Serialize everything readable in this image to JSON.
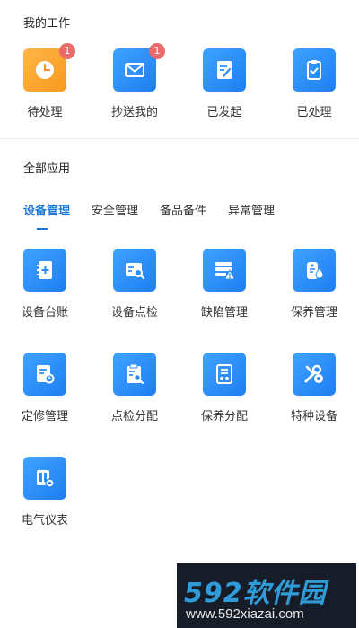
{
  "my_work": {
    "title": "我的工作",
    "items": [
      {
        "label": "待处理",
        "badge": "1",
        "icon": "clock-icon",
        "color": "#f7981c"
      },
      {
        "label": "抄送我的",
        "badge": "1",
        "icon": "mail-icon",
        "color": "#2b8cf5"
      },
      {
        "label": "已发起",
        "icon": "edit-document-icon",
        "color": "#2b8cf5"
      },
      {
        "label": "已处理",
        "icon": "clipboard-check-icon",
        "color": "#2b8cf5"
      }
    ]
  },
  "all_apps": {
    "title": "全部应用",
    "tabs": [
      {
        "label": "设备管理",
        "active": true
      },
      {
        "label": "安全管理"
      },
      {
        "label": "备品备件"
      },
      {
        "label": "异常管理"
      }
    ],
    "apps": [
      {
        "label": "设备台账",
        "icon": "ledger-book-icon"
      },
      {
        "label": "设备点检",
        "icon": "inspection-search-icon"
      },
      {
        "label": "缺陷管理",
        "icon": "defect-warning-icon"
      },
      {
        "label": "保养管理",
        "icon": "maintenance-tag-icon"
      },
      {
        "label": "定修管理",
        "icon": "repair-document-icon"
      },
      {
        "label": "点检分配",
        "icon": "inspection-assign-icon"
      },
      {
        "label": "保养分配",
        "icon": "maintenance-assign-icon"
      },
      {
        "label": "特种设备",
        "icon": "special-equipment-tools-icon"
      },
      {
        "label": "电气仪表",
        "icon": "electrical-instrument-icon"
      }
    ]
  },
  "watermark": {
    "logo": "592软件园",
    "url": "www.592xiazai.com"
  },
  "colors": {
    "accent": "#1e78d8",
    "tile_blue": "#2b8cf5",
    "tile_orange": "#f7981c",
    "badge": "#ea6a6a"
  }
}
